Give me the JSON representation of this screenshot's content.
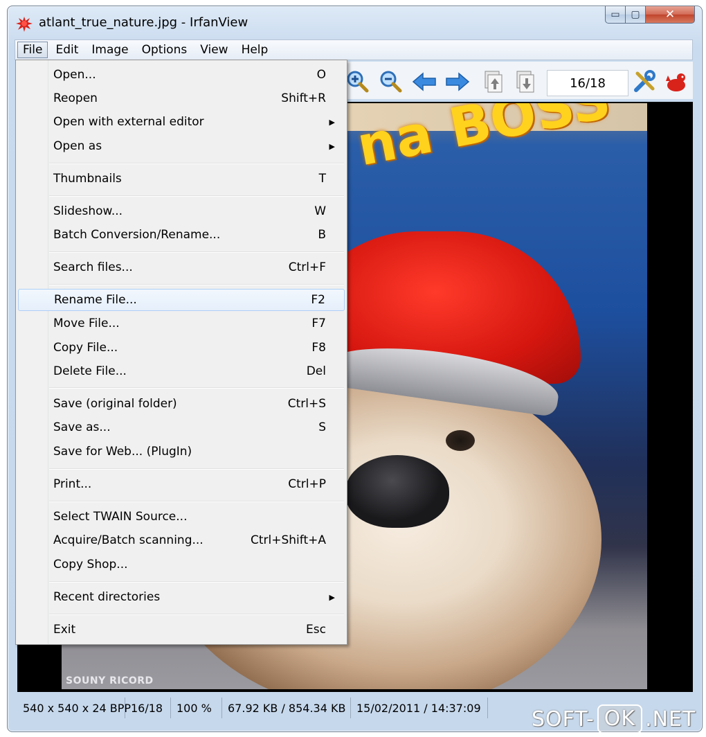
{
  "window": {
    "title": "atlant_true_nature.jpg - IrfanView",
    "caption_buttons": {
      "minimize": "▭",
      "maximize": "▢",
      "close": "✕"
    }
  },
  "menu_bar": [
    "File",
    "Edit",
    "Image",
    "Options",
    "View",
    "Help"
  ],
  "active_menu": "File",
  "toolbar": {
    "icons": [
      "zoom-in-icon",
      "zoom-out-icon",
      "previous-arrow-icon",
      "next-arrow-icon",
      "page-up-icon",
      "page-down-icon",
      "settings-tools-icon",
      "irfanview-logo-icon"
    ],
    "page_counter": "16/18"
  },
  "file_menu": {
    "items": [
      {
        "label": "Open...",
        "shortcut": "O"
      },
      {
        "label": "Reopen",
        "shortcut": "Shift+R"
      },
      {
        "label": "Open with external editor",
        "shortcut": "",
        "submenu": true
      },
      {
        "label": "Open as",
        "shortcut": "",
        "submenu": true
      },
      {
        "label": "Thumbnails",
        "shortcut": "T"
      },
      {
        "label": "Slideshow...",
        "shortcut": "W"
      },
      {
        "label": "Batch Conversion/Rename...",
        "shortcut": "B"
      },
      {
        "label": "Search files...",
        "shortcut": "Ctrl+F"
      },
      {
        "label": "Rename File...",
        "shortcut": "F2",
        "highlighted": true
      },
      {
        "label": "Move File...",
        "shortcut": "F7"
      },
      {
        "label": "Copy File...",
        "shortcut": "F8"
      },
      {
        "label": "Delete File...",
        "shortcut": "Del"
      },
      {
        "label": "Save (original folder)",
        "shortcut": "Ctrl+S"
      },
      {
        "label": "Save as...",
        "shortcut": "S"
      },
      {
        "label": "Save for Web... (PlugIn)",
        "shortcut": ""
      },
      {
        "label": "Print...",
        "shortcut": "Ctrl+P"
      },
      {
        "label": "Select TWAIN Source...",
        "shortcut": ""
      },
      {
        "label": "Acquire/Batch scanning...",
        "shortcut": "Ctrl+Shift+A"
      },
      {
        "label": "Copy Shop...",
        "shortcut": ""
      },
      {
        "label": "Recent directories",
        "shortcut": "",
        "submenu": true
      },
      {
        "label": "Exit",
        "shortcut": "Esc"
      }
    ],
    "submenu_arrow": "▶"
  },
  "image": {
    "graffiti_text": "na BOSS",
    "watermark": "SOUNY RICORD"
  },
  "status_bar": {
    "dimensions": "540 x 540 x 24 BPP",
    "index": "16/18",
    "zoom": "100 %",
    "size": "67.92 KB / 854.34 KB",
    "datetime": "15/02/2011 / 14:37:09"
  },
  "site_watermark": {
    "left": "SOFT-",
    "box": "OK",
    "right": ".NET"
  }
}
